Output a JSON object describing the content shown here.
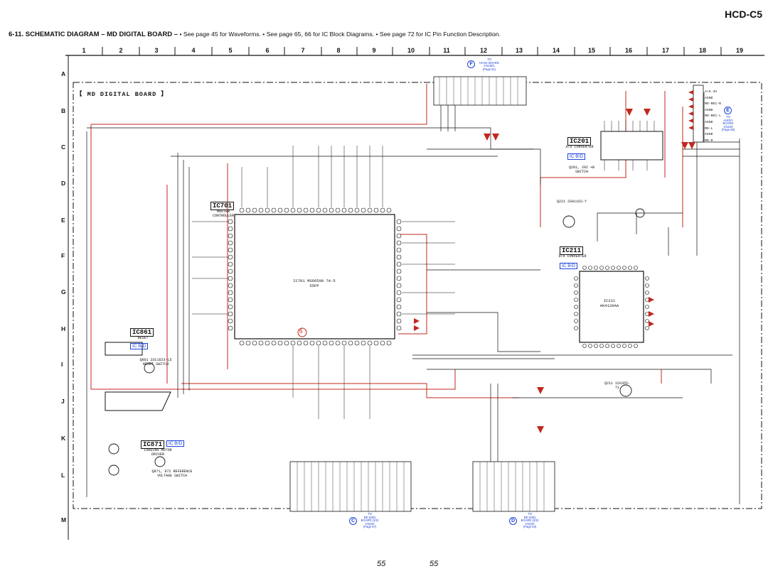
{
  "model": "HCD-C5",
  "heading": {
    "title": "6-11. SCHEMATIC DIAGRAM – MD DIGITAL BOARD –",
    "notes": "• See page 45 for Waveforms.   • See page 65, 66 for IC Block Diagrams.   • See page 72 for IC Pin Function Description."
  },
  "column_labels": [
    "1",
    "2",
    "3",
    "4",
    "5",
    "6",
    "7",
    "8",
    "9",
    "10",
    "11",
    "12",
    "13",
    "14",
    "15",
    "16",
    "17",
    "18",
    "19"
  ],
  "row_labels": [
    "A",
    "B",
    "C",
    "D",
    "E",
    "F",
    "G",
    "H",
    "I",
    "J",
    "K",
    "L",
    "M"
  ],
  "board_title": "【 MD DIGITAL BOARD 】",
  "ics": {
    "ic701": {
      "label": "IC701",
      "desc": "MASTER CONTROLLER",
      "chip": "IC701 MSO6500 7A-5 55FP"
    },
    "ic201": {
      "label": "IC201",
      "desc": "A/D CONVERTER",
      "tag": "IC B/D",
      "note": "Q201, 202 +B SWITCH"
    },
    "ic211": {
      "label": "IC211",
      "desc": "D/A CONVERTER",
      "tag": "IC B/D",
      "chip": "IC211 AK4120AA"
    },
    "ic861": {
      "label": "IC861",
      "desc": "RESET",
      "tag": "IC B/D"
    },
    "ic871": {
      "label": "IC871",
      "desc": "LOADING MOTOR DRIVER",
      "tag": "IC B/D"
    }
  },
  "transistors": {
    "q861": "Q861 2SC1623-L5 RESET SWITCH",
    "q871": "Q871, 872 REFERENCE VOLTAGE SWITCH",
    "q221": "Q221 2SA1162-Y",
    "q211": "Q211 1SS355-T1"
  },
  "connectors": {
    "A": {
      "letter": "F",
      "lines": [
        "TO",
        "HCSK BOARD",
        "CN1501",
        "(Page 51)"
      ]
    },
    "E": {
      "letter": "E",
      "lines": [
        "TO",
        "AUDIO",
        "BOARD",
        "CN103",
        "(Page 58)"
      ]
    },
    "C": {
      "letter": "C",
      "lines": [
        "TO",
        "BD (MD)",
        "BOARD (1/2)",
        "CN102",
        "(Page 57)"
      ]
    },
    "D": {
      "letter": "D",
      "lines": [
        "TO",
        "BD (MD)",
        "BOARD (2/2)",
        "CN103",
        "(Page 53)"
      ]
    }
  },
  "right_io_labels": [
    "A+5.3V",
    "AGND",
    "MD-REC-R",
    "AGND",
    "MD-REC-L",
    "AGND",
    "MD-L",
    "AGND",
    "MD-R"
  ],
  "page_numbers": [
    "55",
    "55"
  ],
  "waveform_marker": "6",
  "colors": {
    "accent_blue": "#1c43d8",
    "signal_red": "#c0281e",
    "line": "#111111"
  }
}
